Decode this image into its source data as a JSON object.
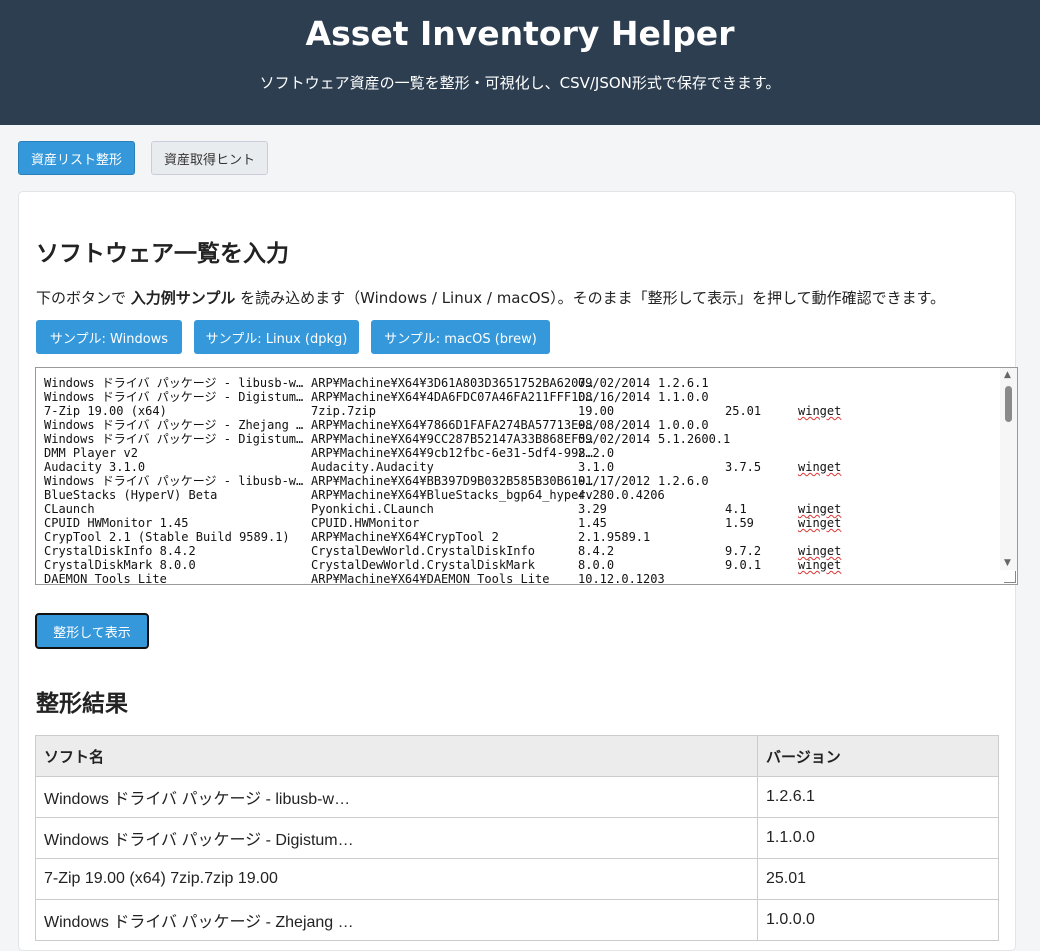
{
  "header": {
    "title": "Asset Inventory Helper",
    "subtitle": "ソフトウェア資産の一覧を整形・可視化し、CSV/JSON形式で保存できます。"
  },
  "tabs": [
    {
      "label": "資産リスト整形",
      "active": true
    },
    {
      "label": "資産取得ヒント",
      "active": false
    }
  ],
  "input_section": {
    "title": "ソフトウェア一覧を入力",
    "desc_prefix": "下のボタンで",
    "desc_bold": "入力例サンプル",
    "desc_suffix": "を読み込めます（Windows / Linux / macOS）。そのまま「整形して表示」を押して動作確認できます。",
    "sample_buttons": [
      "サンプル: Windows",
      "サンプル: Linux (dpkg)",
      "サンプル: macOS (brew)"
    ],
    "textarea_rows": [
      [
        "Windows ドライバ パッケージ - libusb-w…",
        "ARP¥Machine¥X64¥3D61A803D3651752BA6207…",
        "09/02/2014",
        "1.2.6.1",
        "",
        ""
      ],
      [
        "Windows ドライバ パッケージ - Digistum…",
        "ARP¥Machine¥X64¥4DA6FDC07A46FA211FFF1D…",
        "08/16/2014",
        "1.1.0.0",
        "",
        ""
      ],
      [
        "7-Zip 19.00 (x64)",
        "7zip.7zip",
        "19.00",
        "",
        "25.01",
        "winget"
      ],
      [
        "Windows ドライバ パッケージ - Zhejang …",
        "ARP¥Machine¥X64¥7866D1FAFA274BA57713E9…",
        "08/08/2014",
        "1.0.0.0",
        "",
        ""
      ],
      [
        "Windows ドライバ パッケージ - Digistum…",
        "ARP¥Machine¥X64¥9CC287B52147A33B868EF5…",
        "09/02/2014",
        "5.1.2600.1",
        "",
        ""
      ],
      [
        "DMM Player v2",
        "ARP¥Machine¥X64¥9cb12fbc-6e31-5df4-998…",
        "2.2.0",
        "",
        "",
        ""
      ],
      [
        "Audacity 3.1.0",
        "Audacity.Audacity",
        "3.1.0",
        "",
        "3.7.5",
        "winget"
      ],
      [
        "Windows ドライバ パッケージ - libusb-w…",
        "ARP¥Machine¥X64¥BB397D9B032B585B30B619…",
        "01/17/2012",
        "1.2.6.0",
        "",
        ""
      ],
      [
        "BlueStacks (HyperV) Beta",
        "ARP¥Machine¥X64¥BlueStacks_bgp64_hyperv",
        "4.280.0.4206",
        "",
        "",
        ""
      ],
      [
        "CLaunch",
        "Pyonkichi.CLaunch",
        "3.29",
        "",
        "4.1",
        "winget"
      ],
      [
        "CPUID HWMonitor 1.45",
        "CPUID.HWMonitor",
        "1.45",
        "",
        "1.59",
        "winget"
      ],
      [
        "CrypTool 2.1 (Stable Build 9589.1)",
        "ARP¥Machine¥X64¥CrypTool 2",
        "2.1.9589.1",
        "",
        "",
        ""
      ],
      [
        "CrystalDiskInfo 8.4.2",
        "CrystalDewWorld.CrystalDiskInfo",
        "8.4.2",
        "",
        "9.7.2",
        "winget"
      ],
      [
        "CrystalDiskMark 8.0.0",
        "CrystalDewWorld.CrystalDiskMark",
        "8.0.0",
        "",
        "9.0.1",
        "winget"
      ],
      [
        "DAEMON Tools Lite",
        "ARP¥Machine¥X64¥DAEMON Tools Lite",
        "10.12.0.1203",
        "",
        "",
        ""
      ]
    ],
    "format_button": "整形して表示"
  },
  "result": {
    "title": "整形結果",
    "columns": [
      "ソフト名",
      "バージョン"
    ],
    "rows": [
      [
        "Windows ドライバ パッケージ - libusb-w…",
        "1.2.6.1"
      ],
      [
        "Windows ドライバ パッケージ - Digistum…",
        "1.1.0.0"
      ],
      [
        "7-Zip 19.00 (x64) 7zip.7zip 19.00",
        "25.01"
      ],
      [
        "Windows ドライバ パッケージ - Zhejang …",
        "1.0.0.0"
      ]
    ]
  }
}
